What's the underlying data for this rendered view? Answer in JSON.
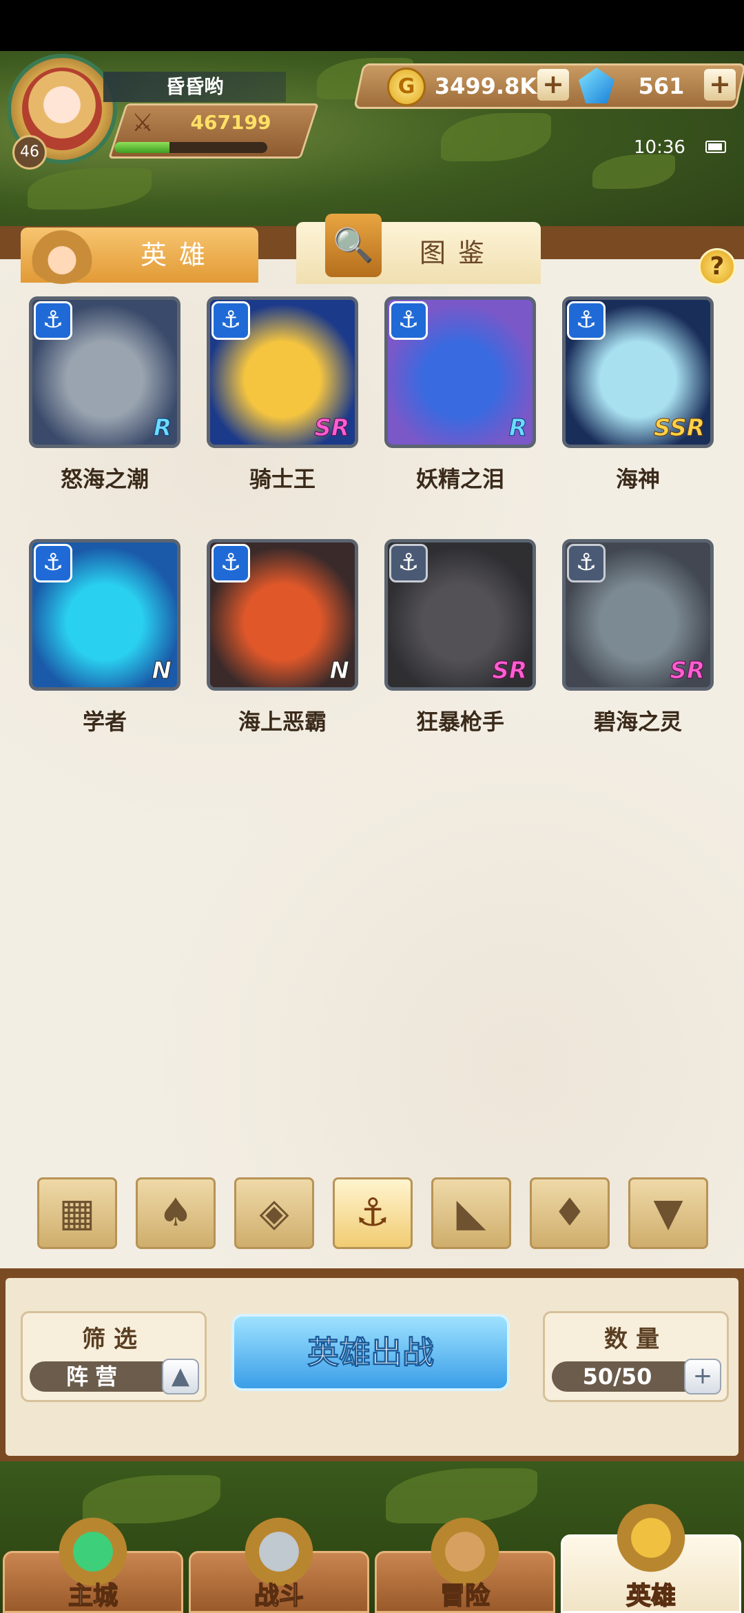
{
  "player": {
    "name": "昏昏哟",
    "level": "46",
    "power": "467199",
    "xp_fraction": 0.36
  },
  "currency": {
    "gold": "3499.8K",
    "gems": "561",
    "plus": "+"
  },
  "status": {
    "time": "10:36"
  },
  "tabs": [
    {
      "label": "英雄",
      "active": false
    },
    {
      "label": "图鉴",
      "active": true
    }
  ],
  "help": "?",
  "heroes": [
    {
      "name": "怒海之潮",
      "rarity": "R",
      "owned": true,
      "colors": [
        "#3a4a6a",
        "#9aa4b0"
      ]
    },
    {
      "name": "骑士王",
      "rarity": "SR",
      "owned": true,
      "colors": [
        "#1c3a8a",
        "#f5c540"
      ]
    },
    {
      "name": "妖精之泪",
      "rarity": "R",
      "owned": true,
      "colors": [
        "#7a58c8",
        "#3a6ae0"
      ]
    },
    {
      "name": "海神",
      "rarity": "SSR",
      "owned": true,
      "colors": [
        "#1a2e5a",
        "#a8e0f0"
      ]
    },
    {
      "name": "学者",
      "rarity": "N",
      "owned": true,
      "colors": [
        "#1a5aa8",
        "#2ad0f0"
      ]
    },
    {
      "name": "海上恶霸",
      "rarity": "N",
      "owned": true,
      "colors": [
        "#3a2a2a",
        "#e0582a"
      ]
    },
    {
      "name": "狂暴枪手",
      "rarity": "SR",
      "owned": false,
      "colors": [
        "#3a3a44",
        "#6a6470"
      ]
    },
    {
      "name": "碧海之灵",
      "rarity": "SR",
      "owned": false,
      "colors": [
        "#4a5a74",
        "#8ab0c8"
      ]
    }
  ],
  "faction_filters": [
    {
      "icon": "grid-icon",
      "glyph": "▦",
      "active": false
    },
    {
      "icon": "leaf-faction-icon",
      "glyph": "♠",
      "active": false
    },
    {
      "icon": "diamond-faction-icon",
      "glyph": "◈",
      "active": false
    },
    {
      "icon": "anchor-faction-icon",
      "glyph": "⚓",
      "active": true
    },
    {
      "icon": "beast-faction-icon",
      "glyph": "◣",
      "active": false
    },
    {
      "icon": "horn-faction-icon",
      "glyph": "♦",
      "active": false
    },
    {
      "icon": "wing-faction-icon",
      "glyph": "▼",
      "active": false
    }
  ],
  "filter_box": {
    "title": "筛选",
    "value": "阵营",
    "toggle": "▲"
  },
  "deploy_button": "英雄出战",
  "count_box": {
    "title": "数量",
    "value": "50/50",
    "plus": "+"
  },
  "nav": [
    {
      "label": "主城",
      "active": false
    },
    {
      "label": "战斗",
      "active": false
    },
    {
      "label": "冒险",
      "active": false
    },
    {
      "label": "英雄",
      "active": true
    }
  ],
  "colors": {
    "accent_gold": "#e29a36",
    "panel": "#f3eee4",
    "wood": "#7a4a22",
    "deploy_blue": "#3a9ee8"
  }
}
